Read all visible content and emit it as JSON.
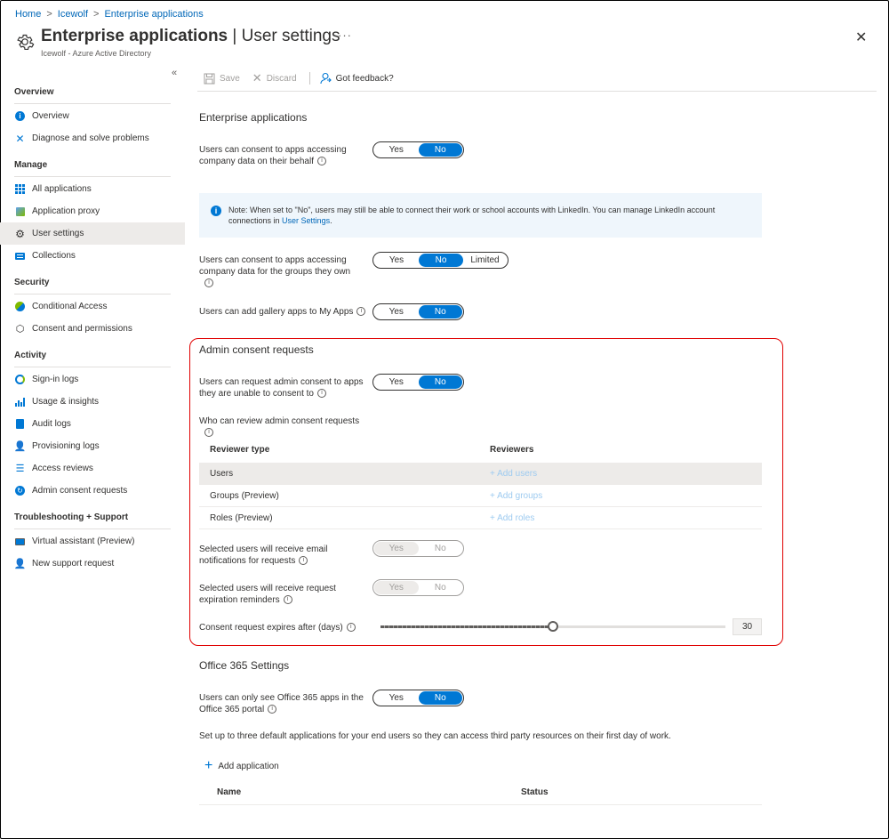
{
  "breadcrumb": [
    "Home",
    "Icewolf",
    "Enterprise applications"
  ],
  "header": {
    "title_main": "Enterprise applications",
    "title_sep": " | ",
    "title_sub": "User settings",
    "subtitle": "Icewolf - Azure Active Directory",
    "more": "···",
    "close": "✕"
  },
  "sidebar": {
    "collapse": "«",
    "overview_head": "Overview",
    "overview_items": [
      {
        "label": "Overview",
        "icon": "info-icon"
      },
      {
        "label": "Diagnose and solve problems",
        "icon": "wrench-icon"
      }
    ],
    "manage_head": "Manage",
    "manage_items": [
      {
        "label": "All applications",
        "icon": "grid-icon"
      },
      {
        "label": "Application proxy",
        "icon": "proxy-icon"
      },
      {
        "label": "User settings",
        "icon": "gear-icon",
        "active": true
      },
      {
        "label": "Collections",
        "icon": "collections-icon"
      }
    ],
    "security_head": "Security",
    "security_items": [
      {
        "label": "Conditional Access",
        "icon": "conditional-access-icon"
      },
      {
        "label": "Consent and permissions",
        "icon": "cube-icon"
      }
    ],
    "activity_head": "Activity",
    "activity_items": [
      {
        "label": "Sign-in logs",
        "icon": "signin-icon"
      },
      {
        "label": "Usage & insights",
        "icon": "chart-icon"
      },
      {
        "label": "Audit logs",
        "icon": "log-icon"
      },
      {
        "label": "Provisioning logs",
        "icon": "person-icon"
      },
      {
        "label": "Access reviews",
        "icon": "list-icon"
      },
      {
        "label": "Admin consent requests",
        "icon": "consent-icon"
      }
    ],
    "support_head": "Troubleshooting + Support",
    "support_items": [
      {
        "label": "Virtual assistant (Preview)",
        "icon": "monitor-icon"
      },
      {
        "label": "New support request",
        "icon": "support-icon"
      }
    ]
  },
  "toolbar": {
    "save": "Save",
    "discard": "Discard",
    "feedback": "Got feedback?"
  },
  "enterprise": {
    "heading": "Enterprise applications",
    "consent_label": "Users can consent to apps accessing company data on their behalf",
    "consent_options": [
      "Yes",
      "No"
    ],
    "consent_selected": "No",
    "note_text": "Note: When set to \"No\", users may still be able to connect their work or school accounts with LinkedIn. You can manage LinkedIn account connections in ",
    "note_link": "User Settings",
    "note_end": ".",
    "groups_label": "Users can consent to apps accessing company data for the groups they own",
    "groups_options": [
      "Yes",
      "No",
      "Limited"
    ],
    "groups_selected": "No",
    "gallery_label": "Users can add gallery apps to My Apps",
    "gallery_options": [
      "Yes",
      "No"
    ],
    "gallery_selected": "No"
  },
  "admin": {
    "heading": "Admin consent requests",
    "request_label": "Users can request admin consent to apps they are unable to consent to",
    "request_options": [
      "Yes",
      "No"
    ],
    "request_selected": "No",
    "who_label": "Who can review admin consent requests",
    "col_type": "Reviewer type",
    "col_reviewers": "Reviewers",
    "rows": [
      {
        "type": "Users",
        "action": "+ Add users"
      },
      {
        "type": "Groups (Preview)",
        "action": "+ Add groups"
      },
      {
        "type": "Roles (Preview)",
        "action": "+ Add roles"
      }
    ],
    "email_label": "Selected users will receive email notifications for requests",
    "email_options": [
      "Yes",
      "No"
    ],
    "email_selected": "Yes",
    "reminder_label": "Selected users will receive request expiration reminders",
    "reminder_options": [
      "Yes",
      "No"
    ],
    "reminder_selected": "Yes",
    "expires_label": "Consent request expires after (days)",
    "expires_value": "30",
    "expires_fraction": 0.5
  },
  "office": {
    "heading": "Office 365 Settings",
    "only_label": "Users can only see Office 365 apps in the Office 365 portal",
    "only_options": [
      "Yes",
      "No"
    ],
    "only_selected": "No",
    "default_text": "Set up to three default applications for your end users so they can access third party resources on their first day of work.",
    "add_app": "Add application",
    "col_name": "Name",
    "col_status": "Status"
  },
  "info_glyph": "i"
}
